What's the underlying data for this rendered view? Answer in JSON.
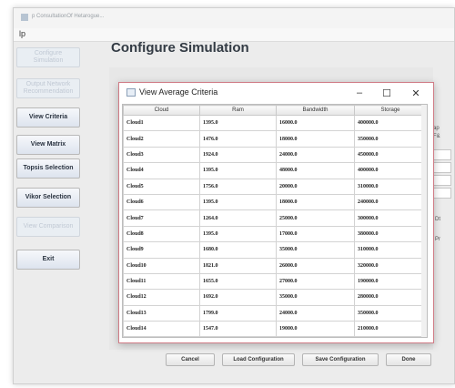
{
  "window": {
    "title": "p ConsultationOf Hetarogue..."
  },
  "menu": {
    "label": "lp"
  },
  "sidebar": {
    "items": [
      {
        "label": "Configure Simulation"
      },
      {
        "label": "Output Network Recommendation"
      },
      {
        "label": "View Criteria"
      },
      {
        "label": "View Matrix"
      },
      {
        "label": "Topsis Selection"
      },
      {
        "label": "Vikor Selection"
      },
      {
        "label": "View Comparison"
      },
      {
        "label": "Exit"
      }
    ]
  },
  "main": {
    "heading": "Configure Simulation",
    "right_labels": [
      "ap",
      "F&",
      "Dt",
      "Pr"
    ]
  },
  "footer": {
    "buttons": [
      "Cancel",
      "Load Configuration",
      "Save Configuration",
      "Done"
    ]
  },
  "dialog": {
    "title": "View Average Criteria",
    "controls": {
      "minimize": "–",
      "maximize": "☐",
      "close": "✕"
    },
    "columns": [
      "Cloud",
      "Ram",
      "Bandwidth",
      "Storage"
    ],
    "rows": [
      [
        "Cloud1",
        "1395.0",
        "16000.0",
        "400000.0"
      ],
      [
        "Cloud2",
        "1476.0",
        "18000.0",
        "350000.0"
      ],
      [
        "Cloud3",
        "1924.0",
        "24000.0",
        "450000.0"
      ],
      [
        "Cloud4",
        "1395.0",
        "48000.0",
        "400000.0"
      ],
      [
        "Cloud5",
        "1756.0",
        "20000.0",
        "310000.0"
      ],
      [
        "Cloud6",
        "1395.0",
        "18000.0",
        "240000.0"
      ],
      [
        "Cloud7",
        "1264.0",
        "25000.0",
        "300000.0"
      ],
      [
        "Cloud8",
        "1395.0",
        "17000.0",
        "380000.0"
      ],
      [
        "Cloud9",
        "1680.0",
        "35000.0",
        "310000.0"
      ],
      [
        "Cloud10",
        "1821.0",
        "26000.0",
        "320000.0"
      ],
      [
        "Cloud11",
        "1655.0",
        "27000.0",
        "190000.0"
      ],
      [
        "Cloud12",
        "1692.0",
        "35000.0",
        "280000.0"
      ],
      [
        "Cloud13",
        "1799.0",
        "24000.0",
        "350000.0"
      ],
      [
        "Cloud14",
        "1547.0",
        "19000.0",
        "210000.0"
      ]
    ]
  }
}
